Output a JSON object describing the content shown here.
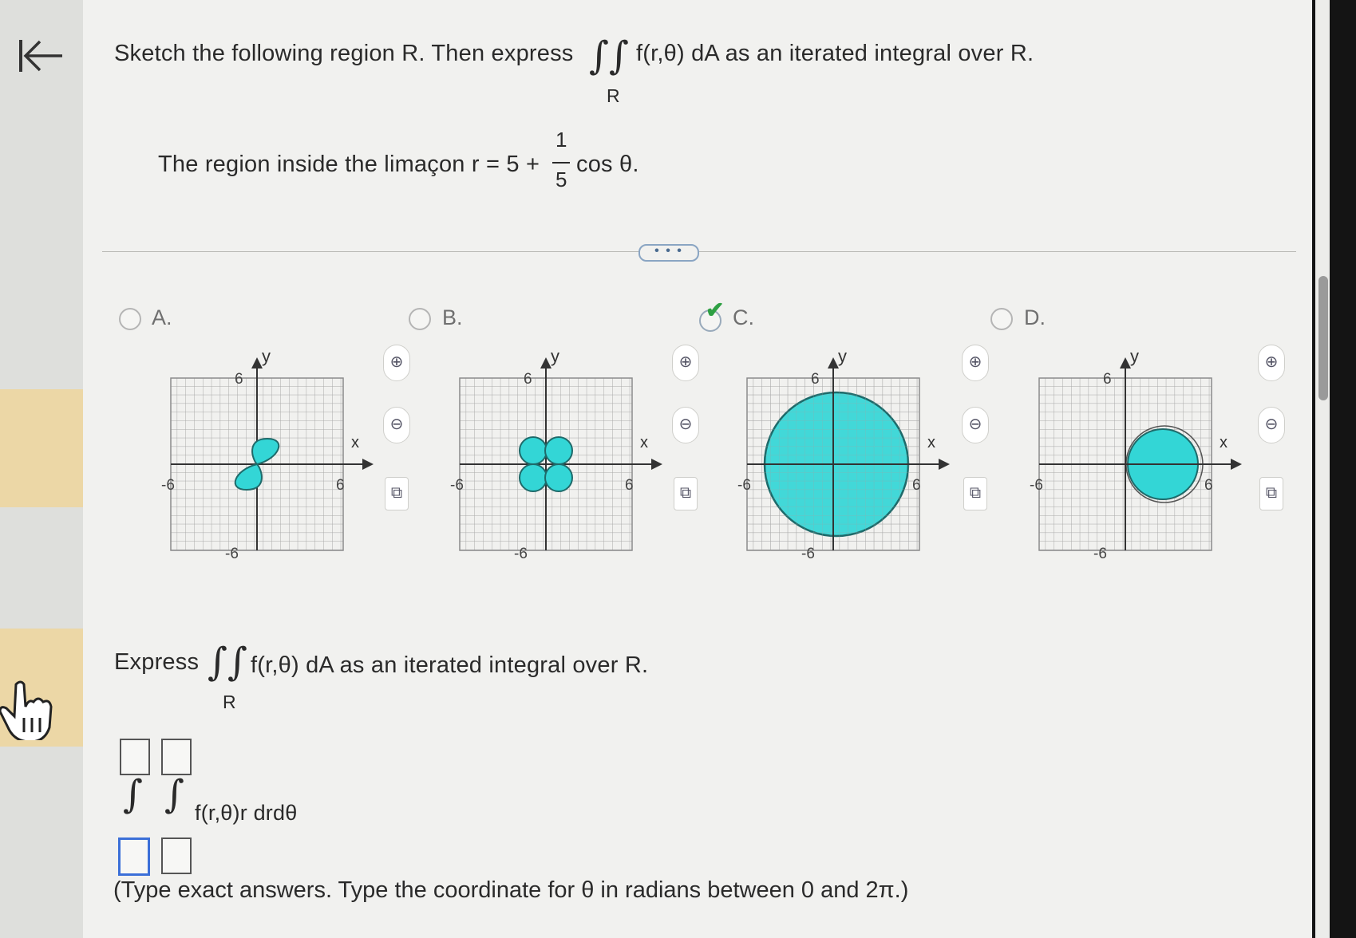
{
  "question": {
    "prefix": "Sketch the following region R. Then express",
    "integrand": "f(r,θ) dA as an iterated integral over R.",
    "region_label": "R"
  },
  "region": {
    "text": "The region inside the limaçon r = 5 +",
    "fraction_num": "1",
    "fraction_den": "5",
    "suffix": "cos θ."
  },
  "more_button": "• • •",
  "options": [
    {
      "letter": "A.",
      "selected": false,
      "shape": "lemniscate"
    },
    {
      "letter": "B.",
      "selected": false,
      "shape": "four-leaf rose"
    },
    {
      "letter": "C.",
      "selected": true,
      "shape": "limaçon"
    },
    {
      "letter": "D.",
      "selected": false,
      "shape": "small circle"
    }
  ],
  "graph_labels": {
    "y": "y",
    "x": "x",
    "top": "6",
    "left": "-6",
    "right": "6",
    "bottom": "-6"
  },
  "express": {
    "prefix": "Express",
    "integrand": "f(r,θ) dA as an iterated integral over R.",
    "region_label": "R"
  },
  "iterated": {
    "integrand": "f(r,θ)r drdθ"
  },
  "note": "(Type exact answers. Type the coordinate for θ in radians between 0 and 2π.)",
  "colors": {
    "fill": "#33d6d6",
    "check": "#2ea043",
    "active_box": "#3b6fd8"
  }
}
